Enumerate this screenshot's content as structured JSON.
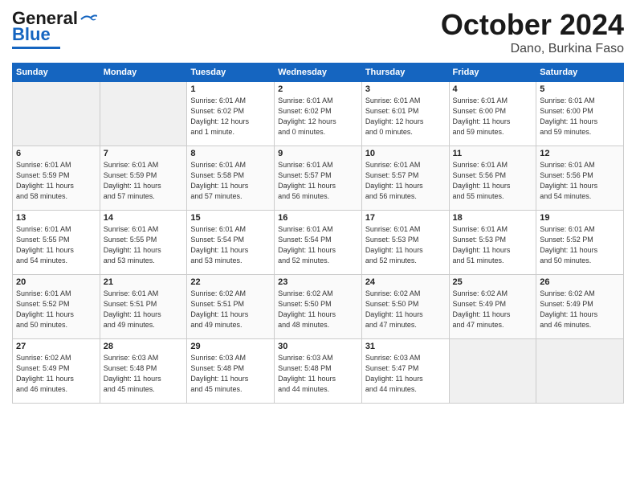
{
  "header": {
    "logo_line1": "General",
    "logo_line2": "Blue",
    "month": "October 2024",
    "location": "Dano, Burkina Faso"
  },
  "weekdays": [
    "Sunday",
    "Monday",
    "Tuesday",
    "Wednesday",
    "Thursday",
    "Friday",
    "Saturday"
  ],
  "weeks": [
    [
      {
        "day": "",
        "info": ""
      },
      {
        "day": "",
        "info": ""
      },
      {
        "day": "1",
        "info": "Sunrise: 6:01 AM\nSunset: 6:02 PM\nDaylight: 12 hours\nand 1 minute."
      },
      {
        "day": "2",
        "info": "Sunrise: 6:01 AM\nSunset: 6:02 PM\nDaylight: 12 hours\nand 0 minutes."
      },
      {
        "day": "3",
        "info": "Sunrise: 6:01 AM\nSunset: 6:01 PM\nDaylight: 12 hours\nand 0 minutes."
      },
      {
        "day": "4",
        "info": "Sunrise: 6:01 AM\nSunset: 6:00 PM\nDaylight: 11 hours\nand 59 minutes."
      },
      {
        "day": "5",
        "info": "Sunrise: 6:01 AM\nSunset: 6:00 PM\nDaylight: 11 hours\nand 59 minutes."
      }
    ],
    [
      {
        "day": "6",
        "info": "Sunrise: 6:01 AM\nSunset: 5:59 PM\nDaylight: 11 hours\nand 58 minutes."
      },
      {
        "day": "7",
        "info": "Sunrise: 6:01 AM\nSunset: 5:59 PM\nDaylight: 11 hours\nand 57 minutes."
      },
      {
        "day": "8",
        "info": "Sunrise: 6:01 AM\nSunset: 5:58 PM\nDaylight: 11 hours\nand 57 minutes."
      },
      {
        "day": "9",
        "info": "Sunrise: 6:01 AM\nSunset: 5:57 PM\nDaylight: 11 hours\nand 56 minutes."
      },
      {
        "day": "10",
        "info": "Sunrise: 6:01 AM\nSunset: 5:57 PM\nDaylight: 11 hours\nand 56 minutes."
      },
      {
        "day": "11",
        "info": "Sunrise: 6:01 AM\nSunset: 5:56 PM\nDaylight: 11 hours\nand 55 minutes."
      },
      {
        "day": "12",
        "info": "Sunrise: 6:01 AM\nSunset: 5:56 PM\nDaylight: 11 hours\nand 54 minutes."
      }
    ],
    [
      {
        "day": "13",
        "info": "Sunrise: 6:01 AM\nSunset: 5:55 PM\nDaylight: 11 hours\nand 54 minutes."
      },
      {
        "day": "14",
        "info": "Sunrise: 6:01 AM\nSunset: 5:55 PM\nDaylight: 11 hours\nand 53 minutes."
      },
      {
        "day": "15",
        "info": "Sunrise: 6:01 AM\nSunset: 5:54 PM\nDaylight: 11 hours\nand 53 minutes."
      },
      {
        "day": "16",
        "info": "Sunrise: 6:01 AM\nSunset: 5:54 PM\nDaylight: 11 hours\nand 52 minutes."
      },
      {
        "day": "17",
        "info": "Sunrise: 6:01 AM\nSunset: 5:53 PM\nDaylight: 11 hours\nand 52 minutes."
      },
      {
        "day": "18",
        "info": "Sunrise: 6:01 AM\nSunset: 5:53 PM\nDaylight: 11 hours\nand 51 minutes."
      },
      {
        "day": "19",
        "info": "Sunrise: 6:01 AM\nSunset: 5:52 PM\nDaylight: 11 hours\nand 50 minutes."
      }
    ],
    [
      {
        "day": "20",
        "info": "Sunrise: 6:01 AM\nSunset: 5:52 PM\nDaylight: 11 hours\nand 50 minutes."
      },
      {
        "day": "21",
        "info": "Sunrise: 6:01 AM\nSunset: 5:51 PM\nDaylight: 11 hours\nand 49 minutes."
      },
      {
        "day": "22",
        "info": "Sunrise: 6:02 AM\nSunset: 5:51 PM\nDaylight: 11 hours\nand 49 minutes."
      },
      {
        "day": "23",
        "info": "Sunrise: 6:02 AM\nSunset: 5:50 PM\nDaylight: 11 hours\nand 48 minutes."
      },
      {
        "day": "24",
        "info": "Sunrise: 6:02 AM\nSunset: 5:50 PM\nDaylight: 11 hours\nand 47 minutes."
      },
      {
        "day": "25",
        "info": "Sunrise: 6:02 AM\nSunset: 5:49 PM\nDaylight: 11 hours\nand 47 minutes."
      },
      {
        "day": "26",
        "info": "Sunrise: 6:02 AM\nSunset: 5:49 PM\nDaylight: 11 hours\nand 46 minutes."
      }
    ],
    [
      {
        "day": "27",
        "info": "Sunrise: 6:02 AM\nSunset: 5:49 PM\nDaylight: 11 hours\nand 46 minutes."
      },
      {
        "day": "28",
        "info": "Sunrise: 6:03 AM\nSunset: 5:48 PM\nDaylight: 11 hours\nand 45 minutes."
      },
      {
        "day": "29",
        "info": "Sunrise: 6:03 AM\nSunset: 5:48 PM\nDaylight: 11 hours\nand 45 minutes."
      },
      {
        "day": "30",
        "info": "Sunrise: 6:03 AM\nSunset: 5:48 PM\nDaylight: 11 hours\nand 44 minutes."
      },
      {
        "day": "31",
        "info": "Sunrise: 6:03 AM\nSunset: 5:47 PM\nDaylight: 11 hours\nand 44 minutes."
      },
      {
        "day": "",
        "info": ""
      },
      {
        "day": "",
        "info": ""
      }
    ]
  ]
}
